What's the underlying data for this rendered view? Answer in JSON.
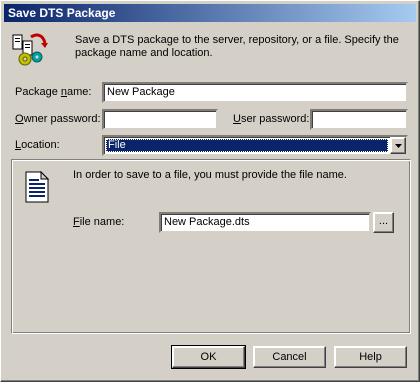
{
  "window": {
    "title": "Save DTS Package"
  },
  "header": {
    "description": "Save a DTS package to the server, repository, or a file.  Specify the package name and location.",
    "icon": "package-gears-icon"
  },
  "form": {
    "package_name": {
      "label_pre": "Package ",
      "label_u": "n",
      "label_post": "ame:",
      "value": "New Package"
    },
    "owner_password": {
      "label_pre": "",
      "label_u": "O",
      "label_post": "wner password:",
      "value": ""
    },
    "user_password": {
      "label_pre": "",
      "label_u": "U",
      "label_post": "ser password:",
      "value": ""
    },
    "location": {
      "label_pre": "",
      "label_u": "L",
      "label_post": "ocation:",
      "value": "File"
    }
  },
  "file_section": {
    "icon": "document-icon",
    "message": "In order to save to a file, you must provide the file name.",
    "file_name": {
      "label_pre": "",
      "label_u": "F",
      "label_post": "ile name:",
      "value": "New Package.dts"
    },
    "browse_label": "..."
  },
  "buttons": {
    "ok": "OK",
    "cancel": "Cancel",
    "help": "Help"
  },
  "colors": {
    "titlebar_start": "#0a246a",
    "titlebar_end": "#a6caf0",
    "selection": "#0a246a",
    "face": "#d4d0c8"
  }
}
